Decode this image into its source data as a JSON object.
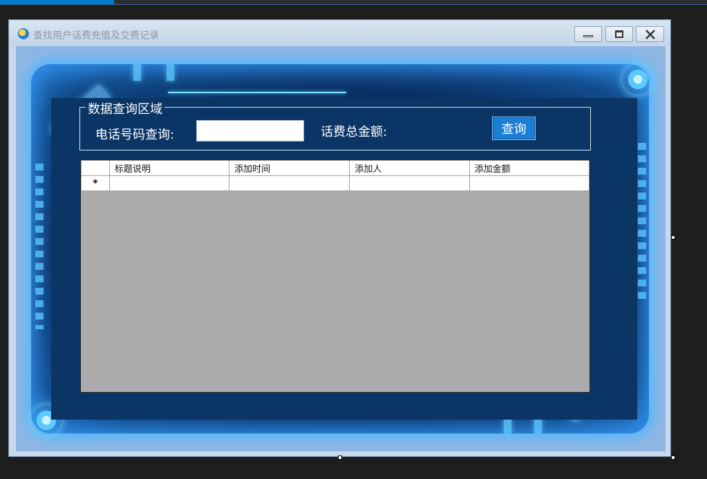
{
  "window": {
    "title": "查找用户话费充值及交费记录",
    "controls": {
      "minimize": "minimize-icon",
      "maximize": "maximize-icon",
      "close": "close-icon"
    }
  },
  "search": {
    "group_title": "数据查询区域",
    "phone_label": "电话号码查询:",
    "phone_value": "",
    "total_label": "话费总金额:",
    "query_button": "查询"
  },
  "grid": {
    "columns": [
      "标题说明",
      "添加时间",
      "添加人",
      "添加金额"
    ],
    "new_row_marker": "*"
  },
  "colors": {
    "panel": "#0b3565",
    "glow": "#4fb6ff",
    "button": "#1a7fd6",
    "grid_background": "#ababab"
  }
}
